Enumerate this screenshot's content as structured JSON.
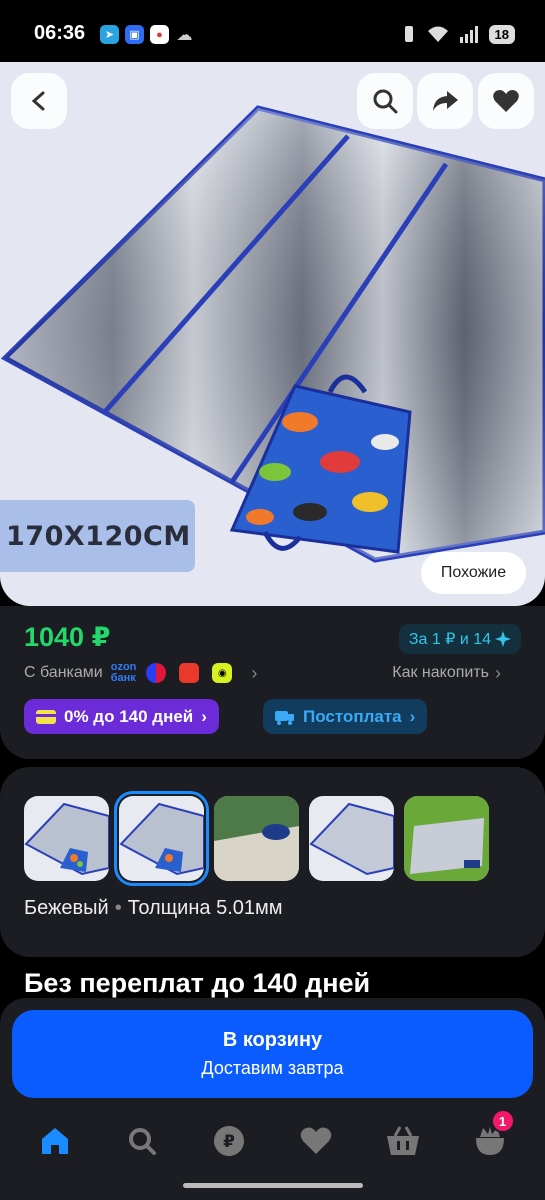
{
  "status_bar": {
    "time": "06:36",
    "battery": "18",
    "left_icons": [
      "telegram-icon",
      "max-icon",
      "vk-icon",
      "cloud-icon"
    ],
    "right_icons": [
      "vibrate-icon",
      "wifi-icon",
      "signal-icon",
      "battery-icon"
    ]
  },
  "hero": {
    "size_label": "170X120CM",
    "similar_label": "Похожие",
    "buttons": [
      "back-icon",
      "search-icon",
      "share-icon",
      "favorite-icon"
    ]
  },
  "pricing": {
    "price": "1040 ₽",
    "bonus": "За 1 ₽ и 14",
    "banks_label": "С банками",
    "ozon_bank_line1": "ozon",
    "ozon_bank_line2": "банк",
    "save_link": "Как накопить",
    "installment": "0% до 140 дней",
    "postpay": "Постоплата"
  },
  "variants": {
    "color": "Бежевый",
    "thickness": "Толщина 5.01мм",
    "selected_index": 1
  },
  "promo_title": "Без переплат до 140 дней",
  "cart": {
    "button": "В корзину",
    "delivery": "Доставим завтра"
  },
  "nav": {
    "items": [
      "home-icon",
      "search-icon",
      "ruble-icon",
      "favorites-icon",
      "cart-icon",
      "profile-icon"
    ],
    "profile_badge": "1"
  },
  "colors": {
    "price": "#24d76b",
    "accent_blue": "#0b5cff",
    "installment_purple": "#6c2bd9",
    "badge_pink": "#f2186a"
  }
}
